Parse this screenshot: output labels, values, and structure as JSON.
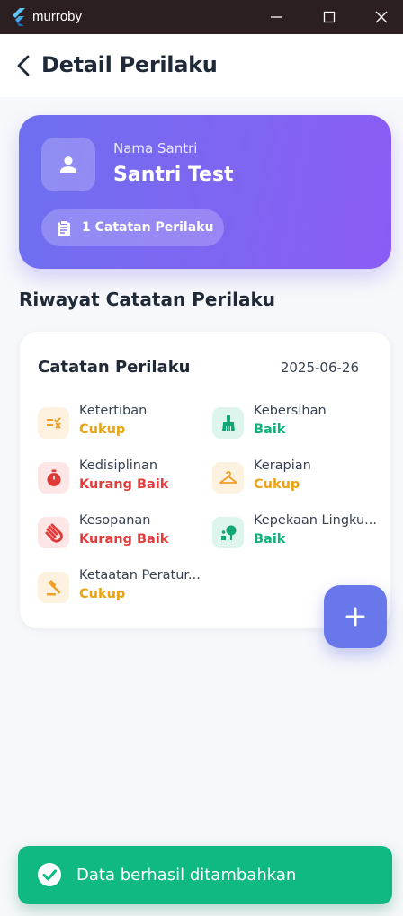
{
  "window": {
    "app_name": "murroby",
    "brand_color": "#2b1f22"
  },
  "appbar": {
    "title": "Detail Perilaku"
  },
  "hero": {
    "label": "Nama Santri",
    "name": "Santri Test",
    "count_label": "1 Catatan Perilaku",
    "gradient": [
      "#6e6ff0",
      "#8b5cf6"
    ]
  },
  "section": {
    "title": "Riwayat Catatan Perilaku"
  },
  "records": [
    {
      "title": "Catatan Perilaku",
      "date": "2025-06-26",
      "items": [
        {
          "name": "Ketertiban",
          "value": "Cukup",
          "icon": "checklist-icon",
          "tone": "orange"
        },
        {
          "name": "Kebersihan",
          "value": "Baik",
          "icon": "broom-icon",
          "tone": "green"
        },
        {
          "name": "Kedisiplinan",
          "value": "Kurang Baik",
          "icon": "timer-icon",
          "tone": "red"
        },
        {
          "name": "Kerapian",
          "value": "Cukup",
          "icon": "hanger-icon",
          "tone": "orange"
        },
        {
          "name": "Kesopanan",
          "value": "Kurang Baik",
          "icon": "waving-hand-icon",
          "tone": "red"
        },
        {
          "name": "Kepekaan Lingku...",
          "value": "Baik",
          "icon": "tree-person-icon",
          "tone": "green"
        },
        {
          "name": "Ketaatan Peratur...",
          "value": "Cukup",
          "icon": "gavel-icon",
          "tone": "orange"
        }
      ]
    }
  ],
  "toast": {
    "message": "Data berhasil ditambahkan",
    "color": "#10b981"
  },
  "colors": {
    "cukup": "#e9a30f",
    "kurang_baik": "#e23d3d",
    "baik": "#10b07e",
    "fab": "#6877ea"
  }
}
